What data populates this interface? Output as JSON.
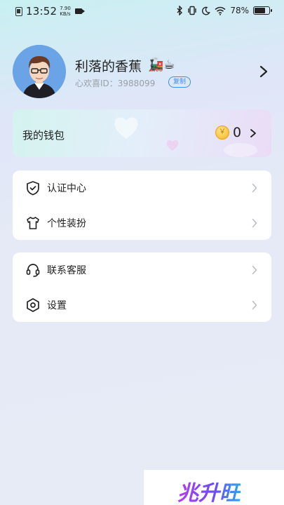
{
  "status_bar": {
    "time": "13:52",
    "net_speed_value": "7.90",
    "net_speed_unit": "KB/s",
    "battery_text": "78%",
    "battery_level": 0.78
  },
  "profile": {
    "username": "利落的香蕉",
    "emoji": "🚂☕",
    "id_text": "心欢喜ID：3988099",
    "copy_label": "复制"
  },
  "wallet": {
    "title": "我的钱包",
    "coin_symbol": "￥",
    "balance": "0"
  },
  "menu_group_1": [
    {
      "label": "认证中心",
      "icon": "shield-check-icon"
    },
    {
      "label": "个性装扮",
      "icon": "tshirt-icon"
    }
  ],
  "menu_group_2": [
    {
      "label": "联系客服",
      "icon": "headset-icon"
    },
    {
      "label": "设置",
      "icon": "hexagon-gear-icon"
    }
  ],
  "watermark": {
    "text": "兆升旺"
  },
  "colors": {
    "accent_blue": "#3a8fe8",
    "avatar_bg": "#6aa3e6",
    "coin_gold": "#f5b41e"
  }
}
